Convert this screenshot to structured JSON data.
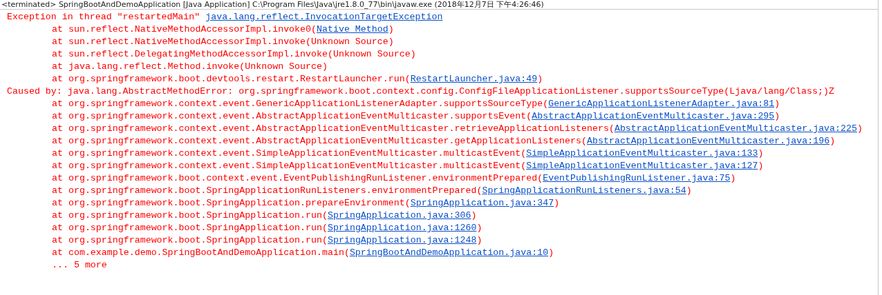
{
  "header": {
    "title": "<terminated> SpringBootAndDemoApplication [Java Application] C:\\Program Files\\Java\\jre1.8.0_77\\bin\\javaw.exe (2018年12月7日 下午4:26:46)"
  },
  "console": {
    "lines": [
      {
        "kind": "exception",
        "text": "Exception in thread \"restartedMain\" ",
        "link": "java.lang.reflect.InvocationTargetException"
      },
      {
        "kind": "frame",
        "text": "at sun.reflect.NativeMethodAccessorImpl.invoke0(",
        "link": "Native Method",
        "suffix": ")"
      },
      {
        "kind": "frame",
        "text": "at sun.reflect.NativeMethodAccessorImpl.invoke(Unknown Source)"
      },
      {
        "kind": "frame",
        "text": "at sun.reflect.DelegatingMethodAccessorImpl.invoke(Unknown Source)"
      },
      {
        "kind": "frame",
        "text": "at java.lang.reflect.Method.invoke(Unknown Source)"
      },
      {
        "kind": "frame",
        "text": "at org.springframework.boot.devtools.restart.RestartLauncher.run(",
        "link": "RestartLauncher.java:49",
        "suffix": ")"
      },
      {
        "kind": "exception",
        "text": "Caused by: java.lang.AbstractMethodError: org.springframework.boot.context.config.ConfigFileApplicationListener.supportsSourceType(Ljava/lang/Class;)Z"
      },
      {
        "kind": "frame",
        "text": "at org.springframework.context.event.GenericApplicationListenerAdapter.supportsSourceType(",
        "link": "GenericApplicationListenerAdapter.java:81",
        "suffix": ")"
      },
      {
        "kind": "frame",
        "text": "at org.springframework.context.event.AbstractApplicationEventMulticaster.supportsEvent(",
        "link": "AbstractApplicationEventMulticaster.java:295",
        "suffix": ")"
      },
      {
        "kind": "frame",
        "text": "at org.springframework.context.event.AbstractApplicationEventMulticaster.retrieveApplicationListeners(",
        "link": "AbstractApplicationEventMulticaster.java:225",
        "suffix": ")"
      },
      {
        "kind": "frame",
        "text": "at org.springframework.context.event.AbstractApplicationEventMulticaster.getApplicationListeners(",
        "link": "AbstractApplicationEventMulticaster.java:196",
        "suffix": ")"
      },
      {
        "kind": "frame",
        "text": "at org.springframework.context.event.SimpleApplicationEventMulticaster.multicastEvent(",
        "link": "SimpleApplicationEventMulticaster.java:133",
        "suffix": ")"
      },
      {
        "kind": "frame",
        "text": "at org.springframework.context.event.SimpleApplicationEventMulticaster.multicastEvent(",
        "link": "SimpleApplicationEventMulticaster.java:127",
        "suffix": ")"
      },
      {
        "kind": "frame",
        "text": "at org.springframework.boot.context.event.EventPublishingRunListener.environmentPrepared(",
        "link": "EventPublishingRunListener.java:75",
        "suffix": ")"
      },
      {
        "kind": "frame",
        "text": "at org.springframework.boot.SpringApplicationRunListeners.environmentPrepared(",
        "link": "SpringApplicationRunListeners.java:54",
        "suffix": ")"
      },
      {
        "kind": "frame",
        "text": "at org.springframework.boot.SpringApplication.prepareEnvironment(",
        "link": "SpringApplication.java:347",
        "suffix": ")"
      },
      {
        "kind": "frame",
        "text": "at org.springframework.boot.SpringApplication.run(",
        "link": "SpringApplication.java:306",
        "suffix": ")"
      },
      {
        "kind": "frame",
        "text": "at org.springframework.boot.SpringApplication.run(",
        "link": "SpringApplication.java:1260",
        "suffix": ")"
      },
      {
        "kind": "frame",
        "text": "at org.springframework.boot.SpringApplication.run(",
        "link": "SpringApplication.java:1248",
        "suffix": ")"
      },
      {
        "kind": "frame",
        "text": "at com.example.demo.SpringBootAndDemoApplication.main(",
        "link": "SpringBootAndDemoApplication.java:10",
        "suffix": ")"
      },
      {
        "kind": "frame",
        "text": "... 5 more"
      }
    ]
  }
}
